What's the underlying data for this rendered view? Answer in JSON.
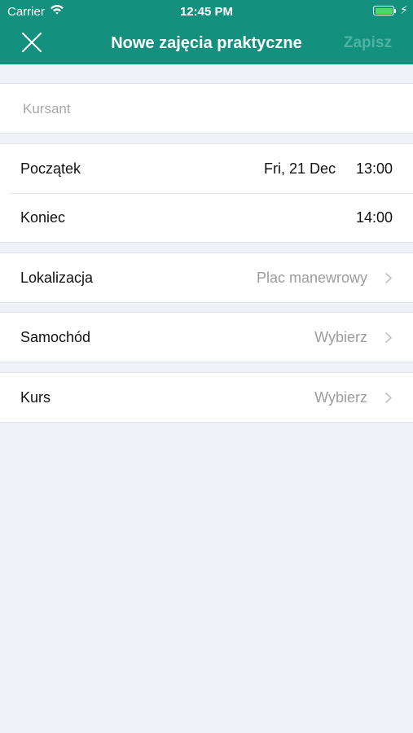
{
  "status_bar": {
    "carrier": "Carrier",
    "time": "12:45 PM"
  },
  "nav": {
    "title": "Nowe zajęcia praktyczne",
    "save_label": "Zapisz"
  },
  "student": {
    "placeholder": "Kursant"
  },
  "start": {
    "label": "Początek",
    "date": "Fri, 21 Dec",
    "time": "13:00"
  },
  "end": {
    "label": "Koniec",
    "time": "14:00"
  },
  "location": {
    "label": "Lokalizacja",
    "value": "Plac manewrowy"
  },
  "car": {
    "label": "Samochód",
    "value": "Wybierz"
  },
  "course": {
    "label": "Kurs",
    "value": "Wybierz"
  },
  "colors": {
    "header": "#13907e",
    "background": "#eff1f6",
    "save_disabled": "#4eb3a3",
    "battery": "#4cd964"
  }
}
